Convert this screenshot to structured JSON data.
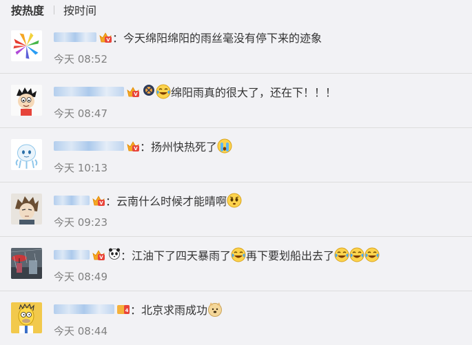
{
  "sort": {
    "hot_label": "按热度",
    "time_label": "按时间"
  },
  "comments": [
    {
      "name_width": 62,
      "segments": [
        "：今天绵阳绵阳的雨丝毫没有停下来的迹象"
      ],
      "time": "今天 08:52",
      "avatar": "rainbow-logo"
    },
    {
      "name_width": 102,
      "segments": [
        "",
        "绵阳雨真的很大了，还在下！！！"
      ],
      "time": "今天 08:47",
      "avatar": "cartoon-boy"
    },
    {
      "name_width": 102,
      "segments": [
        "：扬州快热死了"
      ],
      "time": "今天 10:13",
      "avatar": "ghost-toy"
    },
    {
      "name_width": 52,
      "segments": [
        "：云南什么时候才能晴啊"
      ],
      "time": "今天 09:23",
      "avatar": "anime-boy"
    },
    {
      "name_width": 52,
      "segments": [
        "：江油下了四天暴雨了",
        "再下要划船出去了"
      ],
      "time": "今天 08:49",
      "avatar": "rain-street"
    },
    {
      "name_width": 88,
      "segments": [
        "：北京求雨成功"
      ],
      "time": "今天 08:44",
      "avatar": "yellow-cartoon"
    }
  ],
  "icons": {
    "vip_badge": "vip-crown-icon",
    "fan_badge": "fan-badge-icon",
    "panda_badge": "panda-icon",
    "laugh_cry": "laugh-cry-emoji",
    "cry": "cry-emoji",
    "worry": "worried-emoji",
    "doge": "doge-emoji"
  },
  "colors": {
    "background": "#f2f2f5",
    "time": "#808080",
    "divider": "#dcdcdc"
  }
}
